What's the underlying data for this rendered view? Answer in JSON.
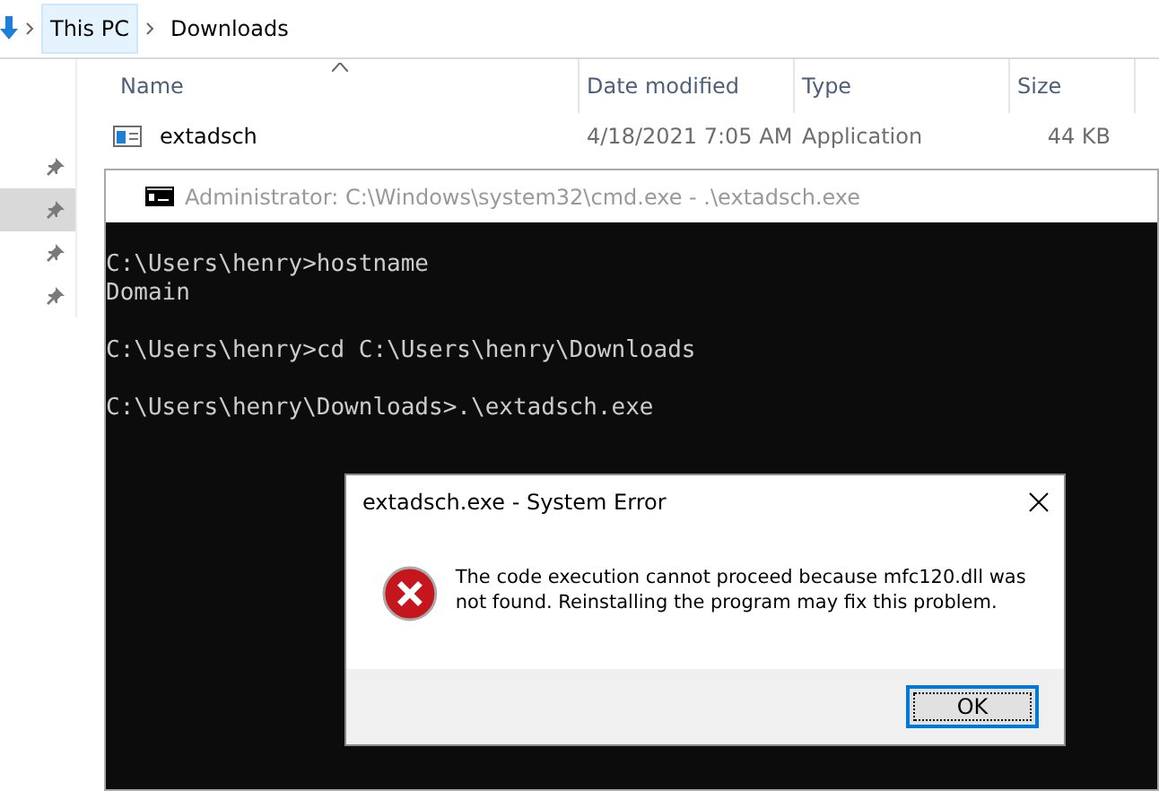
{
  "explorer": {
    "breadcrumb": [
      {
        "label": "This PC",
        "selected": true
      },
      {
        "label": "Downloads",
        "selected": false
      }
    ],
    "nav_pins": [
      {
        "selected": false
      },
      {
        "selected": true
      },
      {
        "selected": false
      },
      {
        "selected": false
      }
    ],
    "columns": [
      "Name",
      "Date modified",
      "Type",
      "Size"
    ],
    "files": [
      {
        "name": "extadsch",
        "date": "4/18/2021 7:05 AM",
        "type": "Application",
        "size": "44 KB"
      }
    ]
  },
  "console": {
    "title": "Administrator: C:\\Windows\\system32\\cmd.exe - .\\extadsch.exe",
    "blocks": [
      [
        "C:\\Users\\henry>hostname",
        "Domain"
      ],
      [
        "C:\\Users\\henry>cd C:\\Users\\henry\\Downloads"
      ],
      [
        "C:\\Users\\henry\\Downloads>.\\extadsch.exe"
      ]
    ]
  },
  "dialog": {
    "title": "extadsch.exe - System Error",
    "message": "The code execution cannot proceed because mfc120.dll was not found. Reinstalling the program may fix this problem.",
    "buttons": [
      "OK"
    ]
  }
}
